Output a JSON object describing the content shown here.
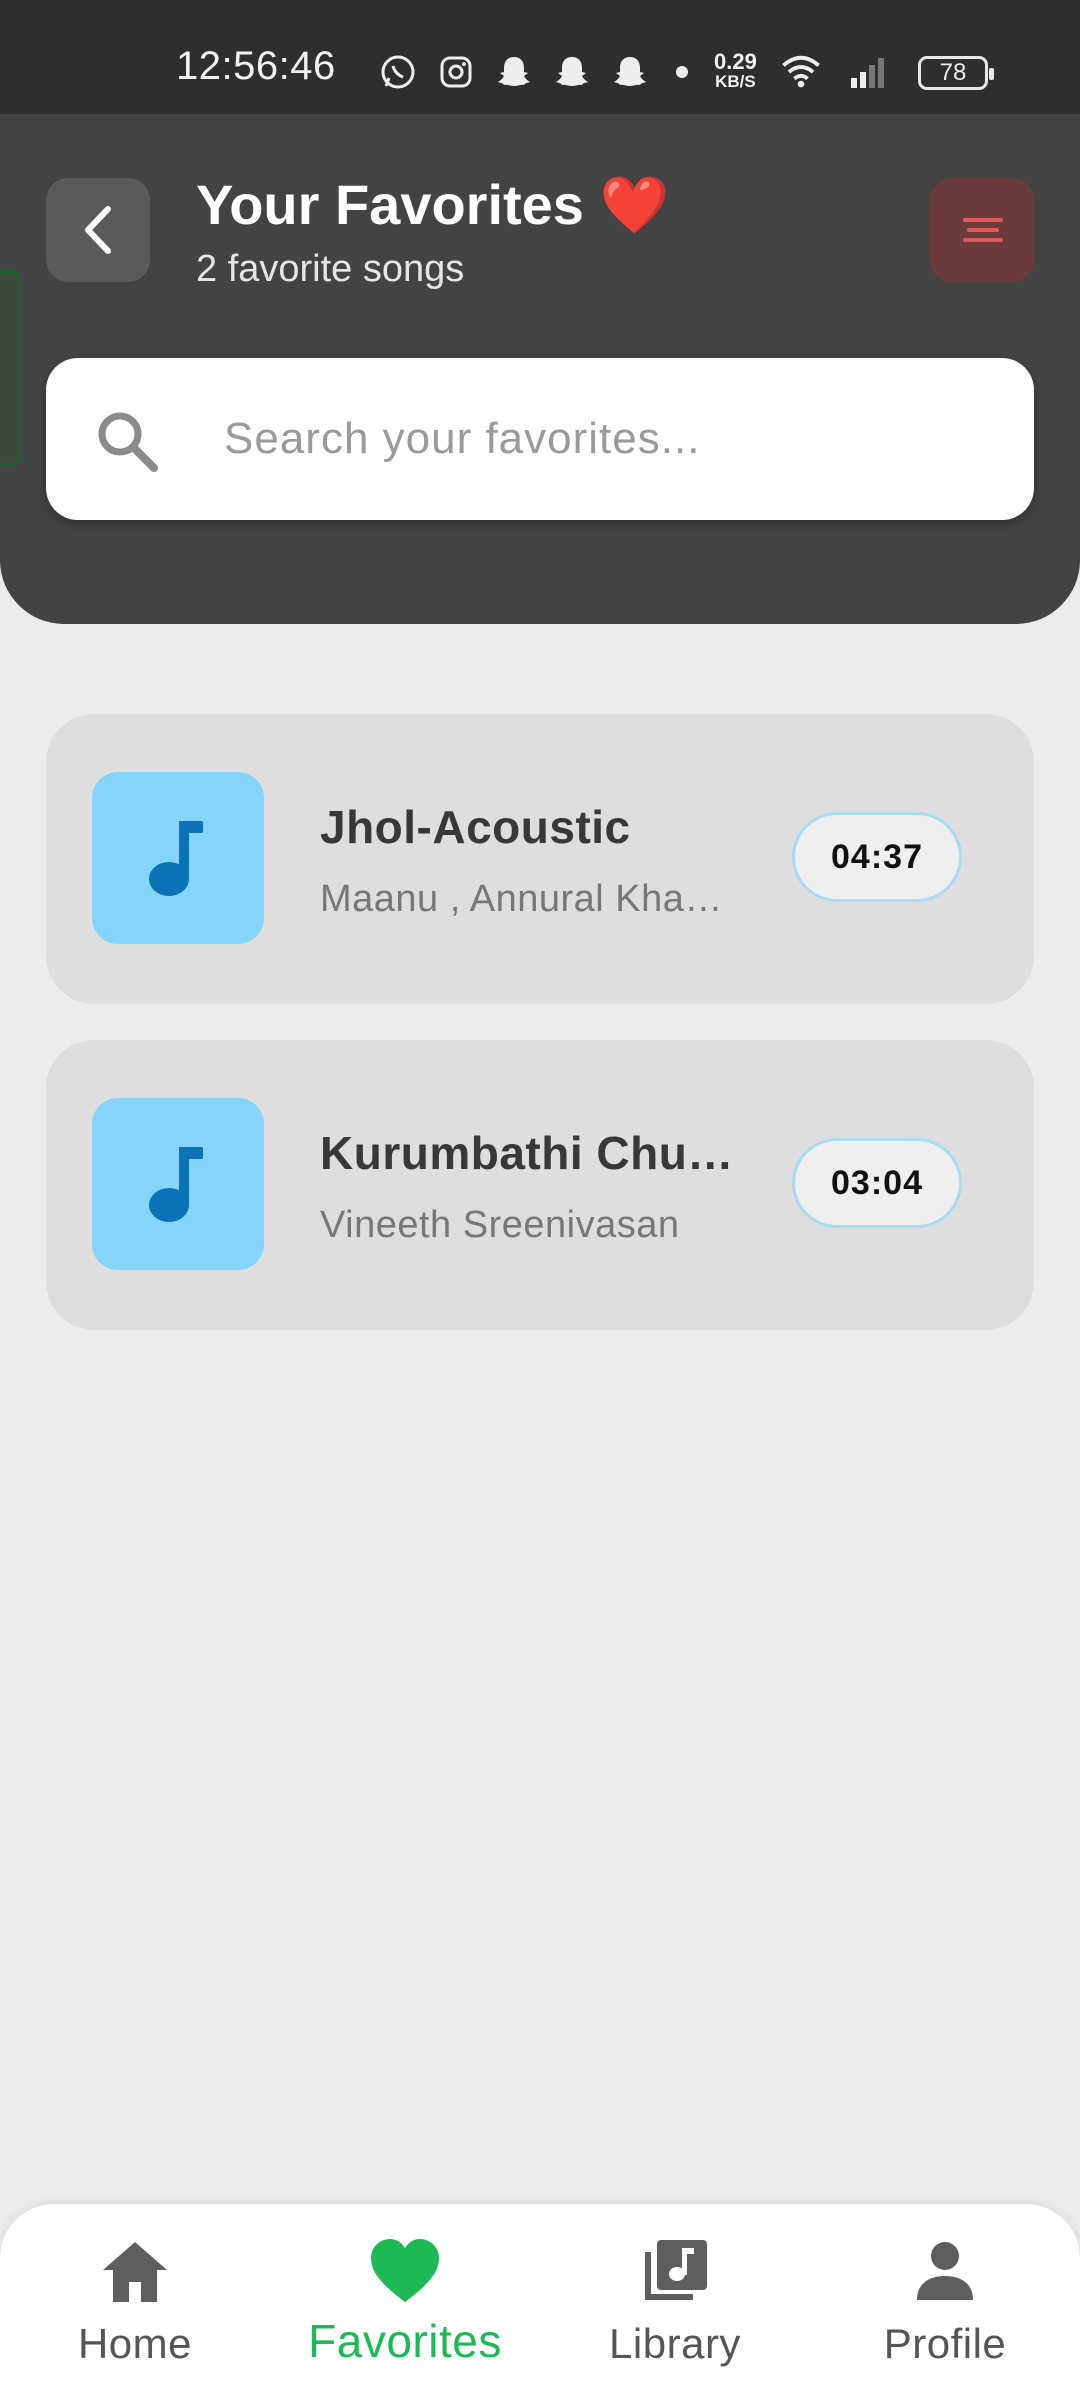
{
  "status_bar": {
    "time": "12:56:46",
    "net_speed_value": "0.29",
    "net_speed_unit": "KB/S",
    "battery": "78",
    "icons": [
      "whatsapp-icon",
      "instagram-icon",
      "snapchat-icon",
      "snapchat-icon",
      "snapchat-icon",
      "dot",
      "wifi-icon",
      "signal-icon",
      "battery-icon"
    ]
  },
  "header": {
    "title": "Your Favorites ❤️",
    "subtitle": "2 favorite songs",
    "back_icon": "chevron-left-icon",
    "menu_icon": "sort-icon"
  },
  "search": {
    "placeholder": "Search your favorites...",
    "value": ""
  },
  "songs": [
    {
      "title": "Jhol-Acoustic",
      "artist": "Maanu , Annural Kha…",
      "duration": "04:37"
    },
    {
      "title": "Kurumbathi Chu…",
      "artist": "Vineeth Sreenivasan",
      "duration": "03:04"
    }
  ],
  "bottom_nav": {
    "items": [
      {
        "label": "Home",
        "icon": "home-icon"
      },
      {
        "label": "Favorites",
        "icon": "heart-icon"
      },
      {
        "label": "Library",
        "icon": "library-icon"
      },
      {
        "label": "Profile",
        "icon": "person-icon"
      }
    ],
    "active": "Favorites"
  },
  "colors": {
    "header_bg": "#434343",
    "accent_green": "#1db954",
    "thumb_bg": "#85d4f9",
    "note_blue": "#0b72b8",
    "menu_btn_bg": "#6b3b3b",
    "menu_lines": "#e05a5a"
  }
}
